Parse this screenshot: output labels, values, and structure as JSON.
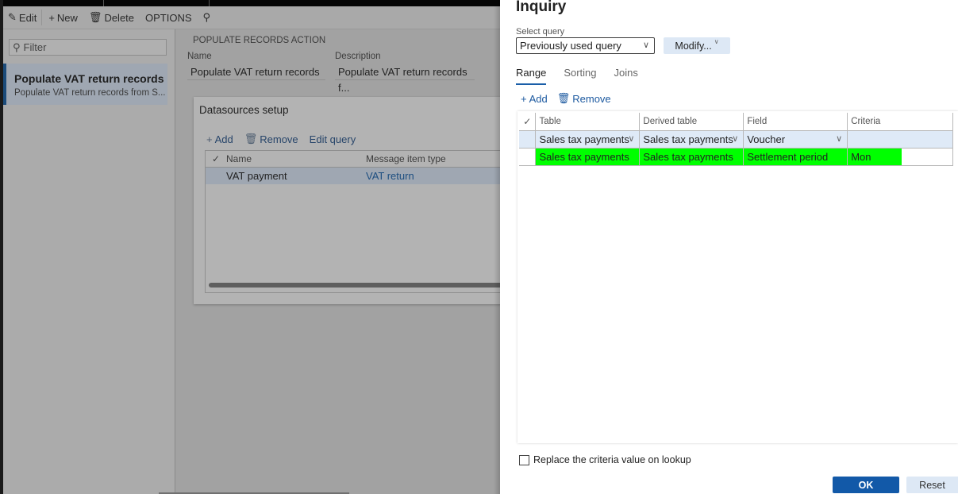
{
  "action_bar": {
    "edit": "Edit",
    "new": "New",
    "delete": "Delete",
    "options": "OPTIONS"
  },
  "list": {
    "filter_placeholder": "Filter",
    "items": [
      {
        "title": "Populate VAT return records",
        "subtitle": "Populate VAT return records from S..."
      }
    ]
  },
  "detail": {
    "section_caption": "POPULATE RECORDS ACTION",
    "name_label": "Name",
    "name_value": "Populate VAT return records",
    "description_label": "Description",
    "description_value": "Populate VAT return records f...",
    "datasources": {
      "title": "Datasources setup",
      "toolbar": {
        "add": "Add",
        "remove": "Remove",
        "edit_query": "Edit query"
      },
      "columns": [
        "Name",
        "Message item type"
      ],
      "rows": [
        {
          "name": "VAT payment",
          "message_item_type": "VAT return"
        }
      ]
    }
  },
  "inquiry": {
    "title": "Inquiry",
    "select_query_label": "Select query",
    "select_query_value": "Previously used query",
    "modify_label": "Modify...",
    "tabs": [
      "Range",
      "Sorting",
      "Joins"
    ],
    "active_tab": "Range",
    "toolbar": {
      "add": "Add",
      "remove": "Remove"
    },
    "columns": [
      "Table",
      "Derived table",
      "Field",
      "Criteria"
    ],
    "rows": [
      {
        "table": "Sales tax payments",
        "derived_table": "Sales tax payments",
        "field": "Voucher",
        "criteria": "",
        "selected": true
      },
      {
        "table": "Sales tax payments",
        "derived_table": "Sales tax payments",
        "field": "Settlement period",
        "criteria": "Mon",
        "highlighted": true
      }
    ],
    "replace_checkbox_label": "Replace the criteria value on lookup",
    "replace_checked": false,
    "ok_label": "OK",
    "reset_label": "Reset",
    "highlight_color": "#00ff00",
    "accent_color": "#1259a8"
  }
}
